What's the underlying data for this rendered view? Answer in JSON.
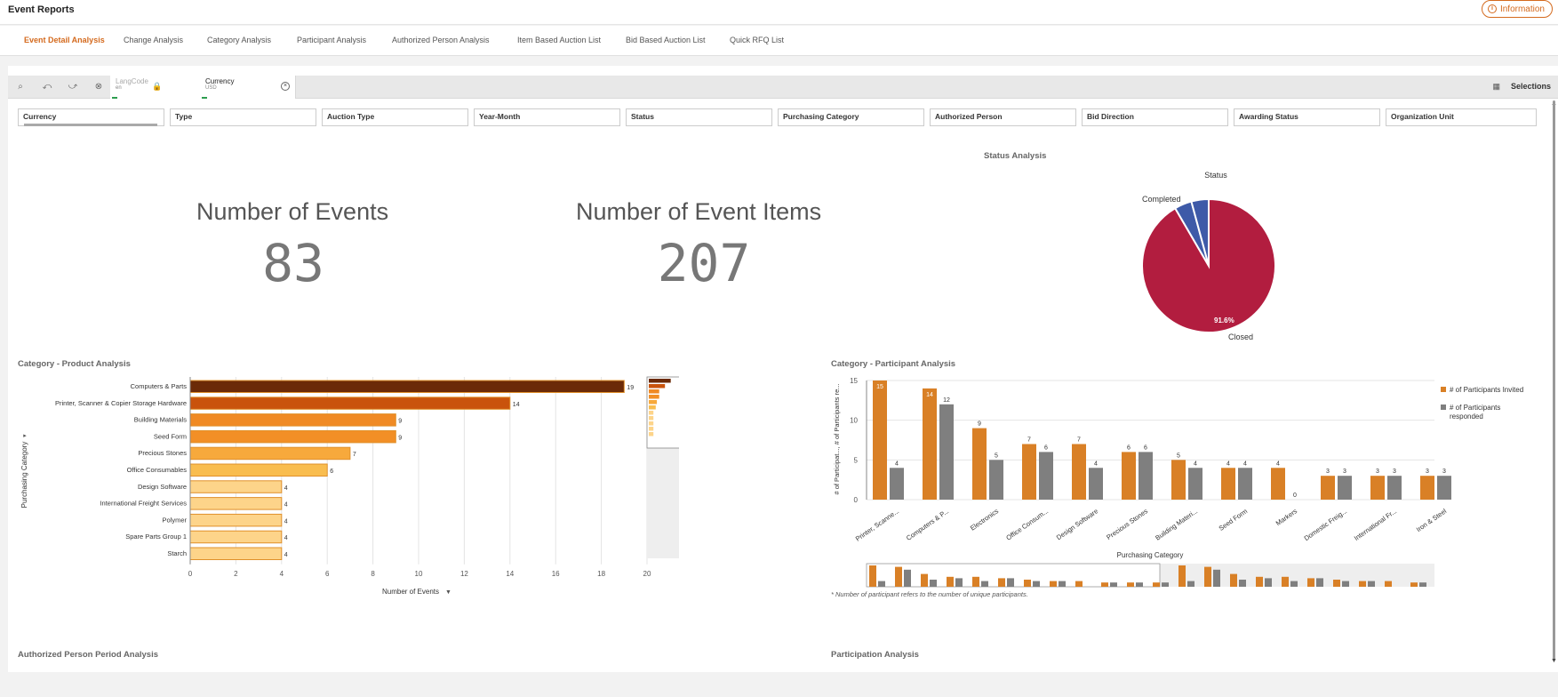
{
  "app": {
    "title": "Event Reports",
    "info_label": "Information"
  },
  "tabs": [
    {
      "label": "Event Detail Analysis",
      "active": true
    },
    {
      "label": "Change Analysis"
    },
    {
      "label": "Category Analysis"
    },
    {
      "label": "Participant Analysis"
    },
    {
      "label": "Authorized Person Analysis"
    },
    {
      "label": "Item Based Auction List"
    },
    {
      "label": "Bid Based Auction List"
    },
    {
      "label": "Quick RFQ List"
    }
  ],
  "toolbar": {
    "chips": [
      {
        "label": "LangCode",
        "value": "en",
        "locked": true
      },
      {
        "label": "Currency",
        "value": "USD"
      }
    ],
    "selections_label": "Selections"
  },
  "filters": [
    "Currency",
    "Type",
    "Auction Type",
    "Year-Month",
    "Status",
    "Purchasing Category",
    "Authorized Person",
    "Bid Direction",
    "Awarding Status",
    "Organization Unit"
  ],
  "kpis": {
    "events": {
      "label": "Number of Events",
      "value": "83"
    },
    "items": {
      "label": "Number of Event Items",
      "value": "207"
    }
  },
  "sections": {
    "status": "Status Analysis",
    "category_product": "Category - Product Analysis",
    "category_participant": "Category - Participant Analysis",
    "authorized_period": "Authorized Person Period Analysis",
    "participation": "Participation Analysis"
  },
  "footnote": "* Number of participant refers to the number of unique participants.",
  "colors": {
    "accent": "#d46a1e",
    "closed": "#b21d3f",
    "completed": "#3e5aa8",
    "invited": "#d98026",
    "responded": "#7f7f7f"
  },
  "chart_data": [
    {
      "type": "pie",
      "title": "Status Analysis",
      "legend_title": "Status",
      "slices": [
        {
          "label": "Closed",
          "value": 91.6,
          "display": "91.6%"
        },
        {
          "label": "Completed",
          "value": 4.2
        },
        {
          "label": "",
          "value": 4.2
        }
      ]
    },
    {
      "type": "bar",
      "orientation": "horizontal",
      "title": "Category - Product Analysis",
      "ylabel": "Purchasing Category",
      "xlabel": "Number of Events",
      "xlim": [
        0,
        20
      ],
      "xticks": [
        0,
        2,
        4,
        6,
        8,
        10,
        12,
        14,
        16,
        18,
        20
      ],
      "categories": [
        "Computers & Parts",
        "Printer, Scanner & Copier Storage Hardware",
        "Building Materials",
        "Seed Form",
        "Precious Stones",
        "Office Consumables",
        "Design Software",
        "International Freight Services",
        "Polymer",
        "Spare Parts Group 1",
        "Starch"
      ],
      "values": [
        19,
        14,
        9,
        9,
        7,
        6,
        4,
        4,
        4,
        4,
        4
      ]
    },
    {
      "type": "bar",
      "title": "Category - Participant Analysis",
      "xlabel": "Purchasing Category",
      "ylabel": "# of Participat..., # of Participants re...",
      "ylim": [
        0,
        15
      ],
      "yticks": [
        0,
        5,
        10,
        15
      ],
      "categories": [
        "Printer, Scanne...",
        "Computers & P...",
        "Electronics",
        "Office Consum...",
        "Design Software",
        "Precious Stones",
        "Building Materi...",
        "Seed Form",
        "Markers",
        "Domestic Freig...",
        "International Fr...",
        "Iron & Steel"
      ],
      "series": [
        {
          "name": "# of Participants Invited",
          "values": [
            15,
            14,
            9,
            7,
            7,
            6,
            5,
            4,
            4,
            3,
            3,
            3
          ]
        },
        {
          "name": "# of Participants responded",
          "values": [
            4,
            12,
            5,
            6,
            4,
            6,
            4,
            4,
            0,
            3,
            3,
            3
          ]
        }
      ]
    }
  ]
}
